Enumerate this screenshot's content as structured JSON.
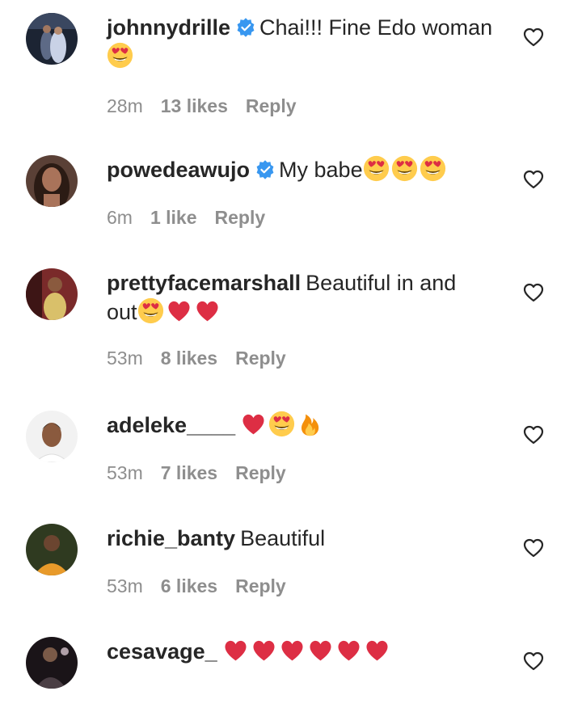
{
  "comments": [
    {
      "username": "johnnydrille",
      "verified": true,
      "text_line1": "Chai!!! Fine Edo woman",
      "emojis": [
        "heart-eyes"
      ],
      "time": "28m",
      "likes": "13 likes",
      "reply": "Reply"
    },
    {
      "username": "powedeawujo",
      "verified": true,
      "text": "My babe",
      "emojis": [
        "heart-eyes",
        "heart-eyes",
        "heart-eyes"
      ],
      "time": "6m",
      "likes": "1 like",
      "reply": "Reply"
    },
    {
      "username": "prettyfacemarshall",
      "verified": false,
      "text_line1": "Beautiful in and",
      "text_line2": "out",
      "emojis": [
        "heart-eyes",
        "red-heart",
        "red-heart"
      ],
      "time": "53m",
      "likes": "8 likes",
      "reply": "Reply"
    },
    {
      "username": "adeleke____",
      "verified": false,
      "text": "",
      "emojis": [
        "red-heart",
        "heart-eyes",
        "fire"
      ],
      "time": "53m",
      "likes": "7 likes",
      "reply": "Reply"
    },
    {
      "username": "richie_banty",
      "verified": false,
      "text": "Beautiful",
      "emojis": [],
      "time": "53m",
      "likes": "6 likes",
      "reply": "Reply"
    },
    {
      "username": "cesavage_",
      "verified": false,
      "text": "",
      "emojis": [
        "red-heart",
        "red-heart",
        "red-heart",
        "red-heart",
        "red-heart",
        "red-heart"
      ]
    }
  ],
  "icons": {
    "like": "heart-outline-icon",
    "verified": "verified-badge-icon"
  },
  "colors": {
    "text": "#262626",
    "meta": "#8e8e8e",
    "verified": "#3897f0",
    "heart": "#e0101e"
  }
}
